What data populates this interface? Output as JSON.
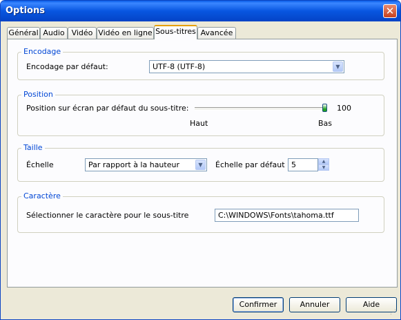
{
  "window": {
    "title": "Options"
  },
  "tabs": [
    "Général",
    "Audio",
    "Vidéo",
    "Vidéo en ligne",
    "Sous-titres",
    "Avancée"
  ],
  "active_tab": "Sous-titres",
  "encodage": {
    "legend": "Encodage",
    "label": "Encodage par défaut:",
    "value": "UTF-8 (UTF-8)"
  },
  "position": {
    "legend": "Position",
    "label": "Position sur écran par défaut du sous-titre:",
    "value": "100",
    "slider_fraction": 1.0,
    "left_label": "Haut",
    "right_label": "Bas"
  },
  "taille": {
    "legend": "Taille",
    "echelle_label": "Échelle",
    "echelle_value": "Par rapport à la hauteur",
    "default_label": "Échelle par défaut",
    "default_value": "5"
  },
  "caractere": {
    "legend": "Caractère",
    "label": "Sélectionner le caractère pour le sous-titre",
    "value": "C:\\WINDOWS\\Fonts\\tahoma.ttf"
  },
  "buttons": {
    "ok": "Confirmer",
    "cancel": "Annuler",
    "help": "Aide"
  },
  "colors": {
    "titlebar": "#0a5ee8",
    "dialog_bg": "#ece9d8",
    "group_legend": "#0046d5",
    "active_tab_accent": "#e6a000",
    "slider_thumb": "#21a121"
  },
  "icons": {
    "close": "close-icon",
    "dropdown": "chevron-down-icon",
    "spin_up": "spin-up-icon",
    "spin_down": "spin-down-icon",
    "size_grip": "resize-grip-icon"
  }
}
